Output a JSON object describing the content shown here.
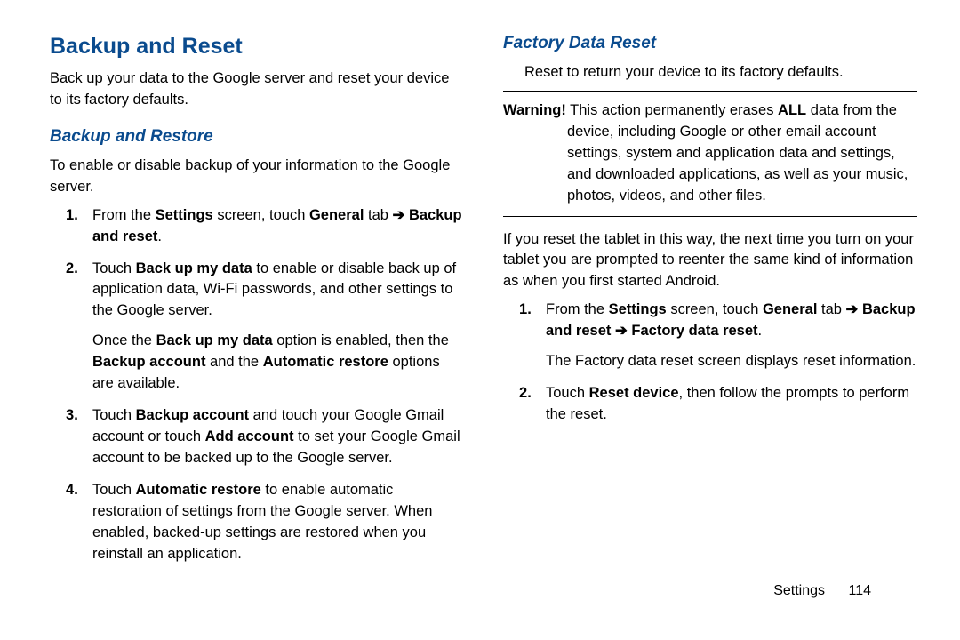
{
  "left": {
    "h1": "Backup and Reset",
    "intro": "Back up your data to the Google server and reset your device to its factory defaults.",
    "h2": "Backup and Restore",
    "intro2": "To enable or disable backup of your information to the Google server.",
    "step1_a": "From the",
    "step1_b": "Settings",
    "step1_c": "screen, touch",
    "step1_d": "General",
    "step1_e": "tab",
    "step1_arrow": "➔",
    "step1_f": "Backup and reset",
    "step1_g": ".",
    "step2_a": "Touch",
    "step2_b": "Back up my data",
    "step2_c": "to enable or disable back up of application data, Wi-Fi passwords, and other settings to the Google server.",
    "step2p2_a": "Once the",
    "step2p2_b": "Back up my data",
    "step2p2_c": "option is enabled, then the",
    "step2p2_d": "Backup account",
    "step2p2_e": "and the",
    "step2p2_f": "Automatic restore",
    "step2p2_g": "options are available.",
    "step3_a": "Touch",
    "step3_b": "Backup account",
    "step3_c": "and touch your Google Gmail account or touch",
    "step3_d": "Add account",
    "step3_e": "to set your Google Gmail account to be backed up to the Google server.",
    "step4_a": "Touch",
    "step4_b": "Automatic restore",
    "step4_c": "to enable automatic restoration of settings from the Google server. When enabled, backed-up settings are restored when you reinstall an application."
  },
  "right": {
    "h2": "Factory Data Reset",
    "intro": "Reset to return your device to its factory defaults.",
    "warn_label": "Warning!",
    "warn_a": "This action permanently erases",
    "warn_b": "ALL",
    "warn_c": "data from the",
    "warn_body": "device, including Google or other email account settings, system and application data and settings, and downloaded applications, as well as your music, photos, videos, and other files.",
    "para2": "If you reset the tablet in this way, the next time you turn on your tablet you are prompted to reenter the same kind of information as when you first started Android.",
    "step1_a": "From the",
    "step1_b": "Settings",
    "step1_c": "screen, touch",
    "step1_d": "General",
    "step1_e": "tab",
    "step1_arrow": "➔",
    "step1_f": "Backup and reset",
    "step1_g": "➔",
    "step1_h": "Factory data reset",
    "step1_i": ".",
    "step1p2": "The Factory data reset screen displays reset information.",
    "step2_a": "Touch",
    "step2_b": "Reset device",
    "step2_c": ", then follow the prompts to perform the reset."
  },
  "footer": {
    "section": "Settings",
    "page": "114"
  }
}
